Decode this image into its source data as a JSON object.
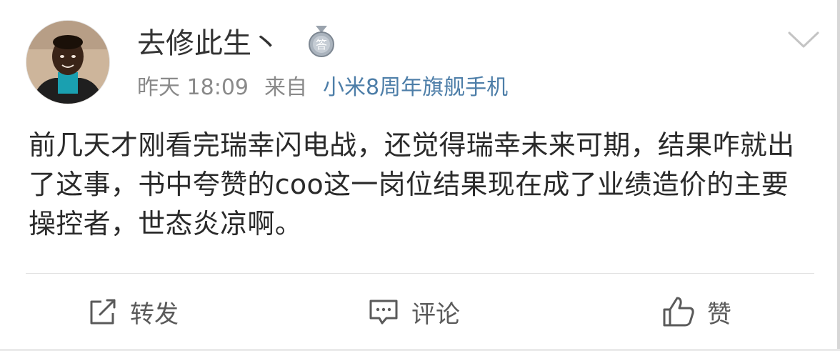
{
  "post": {
    "author": {
      "name": "去修此生丶",
      "medal_char": "答"
    },
    "meta": {
      "time": "昨天 18:09",
      "from_label": "来自",
      "source": "小米8周年旗舰手机"
    },
    "text": "前几天才刚看完瑞幸闪电战，还觉得瑞幸未来可期，结果咋就出了这事，书中夸赞的coo这一岗位结果现在成了业绩造价的主要操控者，世态炎凉啊。"
  },
  "actions": {
    "repost": "转发",
    "comment": "评论",
    "like": "赞"
  },
  "colors": {
    "source_link": "#4d7ea8",
    "meta_gray": "#8a8a8a",
    "action_gray": "#5a5a5a"
  },
  "icons": [
    "avatar",
    "medal-badge-icon",
    "chevron-down-icon",
    "repost-icon",
    "comment-icon",
    "like-icon"
  ]
}
